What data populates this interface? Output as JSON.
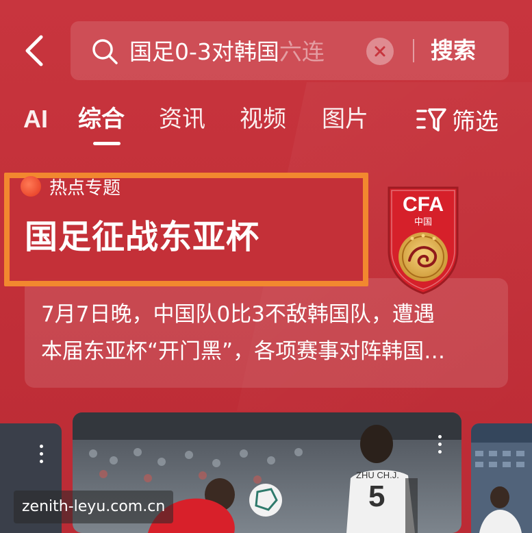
{
  "search": {
    "query_visible": "国足0-3对韩国",
    "query_faded": "六连",
    "submit_label": "搜索"
  },
  "tabs": [
    {
      "label": "AI"
    },
    {
      "label": "综合",
      "active": true
    },
    {
      "label": "资讯"
    },
    {
      "label": "视频"
    },
    {
      "label": "图片"
    }
  ],
  "filter": {
    "label": "筛选",
    "icon": "filter-icon"
  },
  "hot_topic": {
    "tag": "热点专题",
    "title": "国足征战东亚杯",
    "desc_line1": "7月7日晚，中国队0比3不敌韩国队，遭遇",
    "desc_line2": "本届东亚杯“开门黑”，各项赛事对阵韩国…",
    "badge_letters": "CFA",
    "badge_sub": "中国"
  },
  "video": {
    "player_jersey_name": "ZHU CH.J.",
    "player_number": "5"
  },
  "watermark": "zenith-leyu.com.cn",
  "colors": {
    "background": "#c7343d",
    "highlight_border": "#f2882f",
    "text": "#ffffff"
  }
}
